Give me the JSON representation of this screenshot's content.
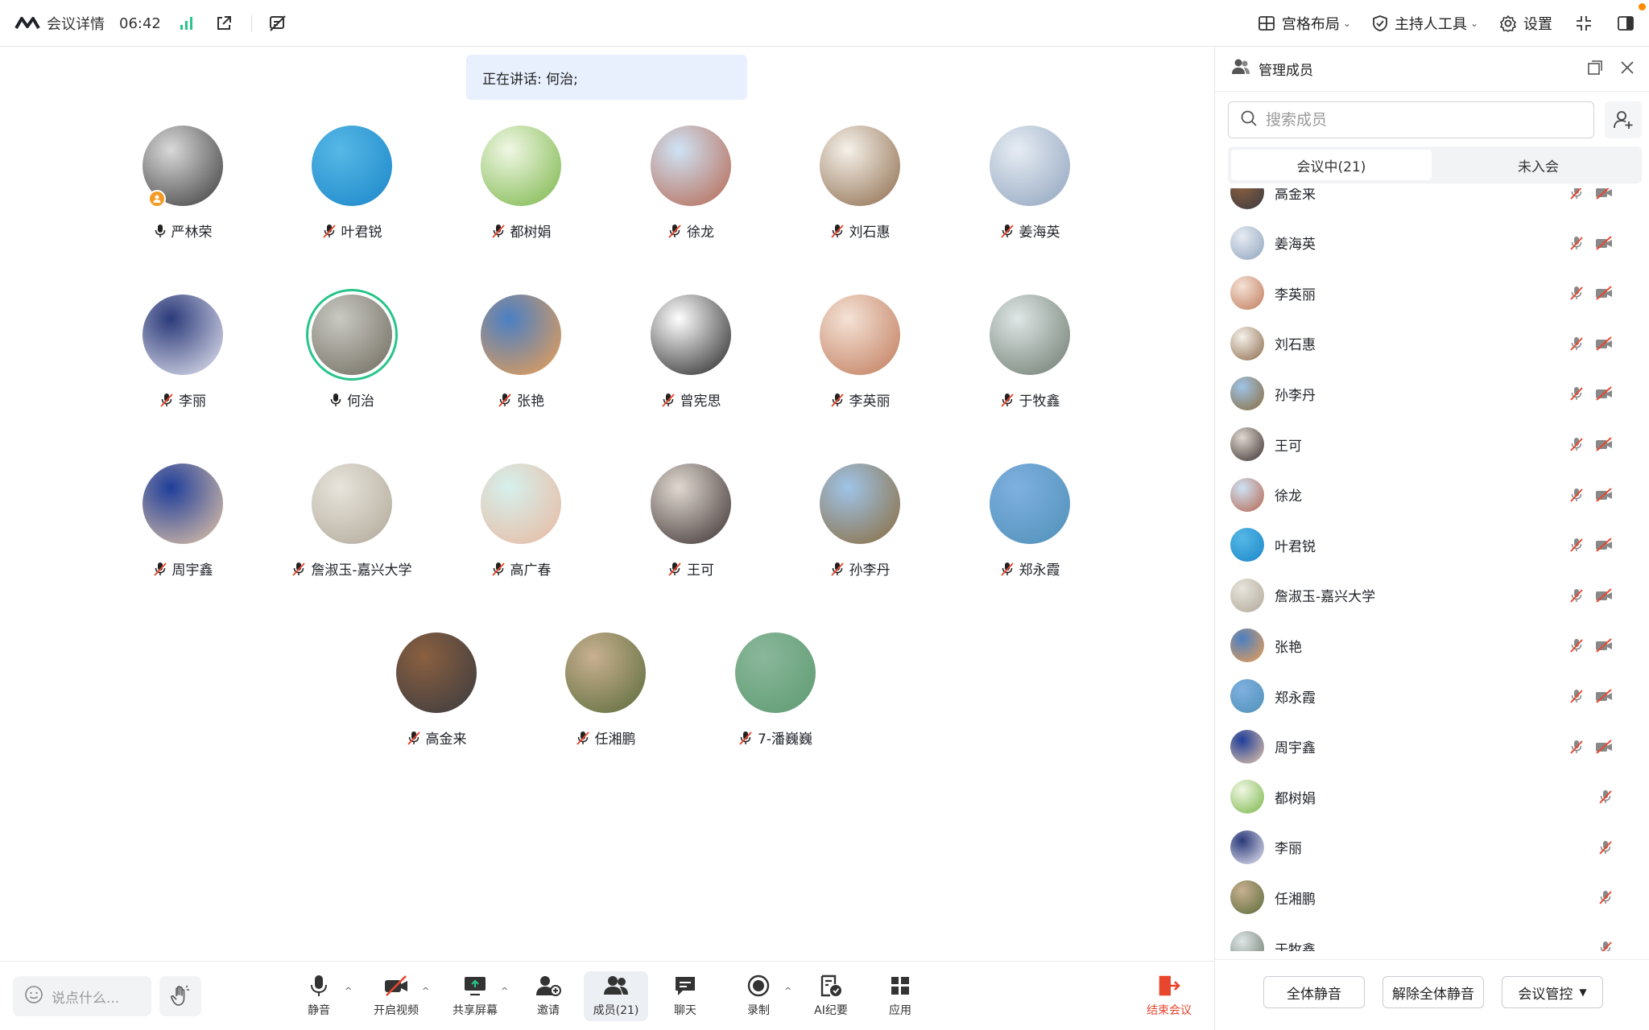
{
  "topbar": {
    "meeting_details": "会议详情",
    "duration": "06:42",
    "layout": "宫格布局",
    "host_tools": "主持人工具",
    "settings": "设置"
  },
  "main": {
    "speaking": "正在讲话: 何治;",
    "participants": [
      {
        "name": "严林荣",
        "mic": "on",
        "host": true,
        "colors": [
          "#d9d9d9",
          "#3a3a3a"
        ]
      },
      {
        "name": "叶君锐",
        "mic": "muted",
        "colors": [
          "#56b8e6",
          "#1b86c8"
        ]
      },
      {
        "name": "都树娟",
        "mic": "muted",
        "colors": [
          "#f0f7e4",
          "#7ab648"
        ]
      },
      {
        "name": "徐龙",
        "mic": "muted",
        "colors": [
          "#cfe3f5",
          "#b5654e"
        ]
      },
      {
        "name": "刘石惠",
        "mic": "muted",
        "colors": [
          "#f5f1ea",
          "#8c6a4a"
        ]
      },
      {
        "name": "姜海英",
        "mic": "muted",
        "colors": [
          "#e6ecf3",
          "#8fa3bd"
        ]
      },
      {
        "name": "李丽",
        "mic": "muted",
        "colors": [
          "#2b3a7a",
          "#e8e8f2"
        ]
      },
      {
        "name": "何治",
        "mic": "on",
        "speaking": true,
        "colors": [
          "#c9c9c2",
          "#6f6a5e"
        ]
      },
      {
        "name": "张艳",
        "mic": "muted",
        "colors": [
          "#4a7fc4",
          "#f0a050"
        ]
      },
      {
        "name": "曾宪思",
        "mic": "muted",
        "colors": [
          "#ffffff",
          "#222222"
        ]
      },
      {
        "name": "李英丽",
        "mic": "muted",
        "colors": [
          "#f4e2d6",
          "#c07a5a"
        ]
      },
      {
        "name": "于牧鑫",
        "mic": "muted",
        "colors": [
          "#dfe6e6",
          "#6c7a6e"
        ]
      },
      {
        "name": "周宇鑫",
        "mic": "muted",
        "colors": [
          "#1f3e9a",
          "#e8c8a8"
        ]
      },
      {
        "name": "詹淑玉-嘉兴大学",
        "mic": "muted",
        "colors": [
          "#e8e4dc",
          "#b0a898"
        ]
      },
      {
        "name": "高广春",
        "mic": "muted",
        "colors": [
          "#d6f0ec",
          "#e8b8a0"
        ]
      },
      {
        "name": "王可",
        "mic": "muted",
        "colors": [
          "#e0d8d0",
          "#3a3030"
        ]
      },
      {
        "name": "孙李丹",
        "mic": "muted",
        "colors": [
          "#9fc4e8",
          "#8a6a3a"
        ]
      },
      {
        "name": "郑永霞",
        "mic": "muted",
        "colors": [
          "#7fb0e0",
          "#4f90b8"
        ]
      },
      {
        "name": "高金来",
        "mic": "muted",
        "colors": [
          "#8a6040",
          "#3a3a40"
        ]
      },
      {
        "name": "任湘鹏",
        "mic": "muted",
        "colors": [
          "#c8b090",
          "#5a6a3a"
        ]
      },
      {
        "name": "7-潘巍巍",
        "mic": "muted",
        "colors": [
          "#8ab89a",
          "#5e9a72"
        ]
      }
    ]
  },
  "bottombar": {
    "say_placeholder": "说点什么...",
    "mute": "静音",
    "video": "开启视频",
    "share": "共享屏幕",
    "invite": "邀请",
    "members": "成员(21)",
    "chat": "聊天",
    "record": "录制",
    "ai_minutes": "AI纪要",
    "apps": "应用",
    "end": "结束会议"
  },
  "panel": {
    "title": "管理成员",
    "search_placeholder": "搜索成员",
    "tab_in_meeting": "会议中(21)",
    "tab_not_joined": "未入会",
    "members": [
      {
        "name": "高金来",
        "cam": true,
        "colors": [
          "#8a6040",
          "#3a3a40"
        ]
      },
      {
        "name": "姜海英",
        "cam": true,
        "colors": [
          "#e6ecf3",
          "#8fa3bd"
        ]
      },
      {
        "name": "李英丽",
        "cam": true,
        "colors": [
          "#f4e2d6",
          "#c07a5a"
        ]
      },
      {
        "name": "刘石惠",
        "cam": true,
        "colors": [
          "#f5f1ea",
          "#8c6a4a"
        ]
      },
      {
        "name": "孙李丹",
        "cam": true,
        "colors": [
          "#9fc4e8",
          "#8a6a3a"
        ]
      },
      {
        "name": "王可",
        "cam": true,
        "colors": [
          "#e0d8d0",
          "#3a3030"
        ]
      },
      {
        "name": "徐龙",
        "cam": true,
        "colors": [
          "#cfe3f5",
          "#b5654e"
        ]
      },
      {
        "name": "叶君锐",
        "cam": true,
        "colors": [
          "#56b8e6",
          "#1b86c8"
        ]
      },
      {
        "name": "詹淑玉-嘉兴大学",
        "cam": true,
        "colors": [
          "#e8e4dc",
          "#b0a898"
        ]
      },
      {
        "name": "张艳",
        "cam": true,
        "colors": [
          "#4a7fc4",
          "#f0a050"
        ]
      },
      {
        "name": "郑永霞",
        "cam": true,
        "colors": [
          "#7fb0e0",
          "#4f90b8"
        ]
      },
      {
        "name": "周宇鑫",
        "cam": true,
        "colors": [
          "#1f3e9a",
          "#e8c8a8"
        ]
      },
      {
        "name": "都树娟",
        "cam": false,
        "colors": [
          "#f0f7e4",
          "#7ab648"
        ]
      },
      {
        "name": "李丽",
        "cam": false,
        "colors": [
          "#2b3a7a",
          "#e8e8f2"
        ]
      },
      {
        "name": "任湘鹏",
        "cam": false,
        "colors": [
          "#c8b090",
          "#5a6a3a"
        ]
      },
      {
        "name": "于牧鑫",
        "cam": false,
        "colors": [
          "#dfe6e6",
          "#6c7a6e"
        ]
      }
    ],
    "mute_all": "全体静音",
    "unmute_all": "解除全体静音",
    "meeting_control": "会议管控"
  },
  "colors": {
    "accent_green": "#28c58a",
    "muted_red": "#e8462d",
    "end_red": "#e8462d",
    "speaking_bg": "#e8f0fe"
  }
}
